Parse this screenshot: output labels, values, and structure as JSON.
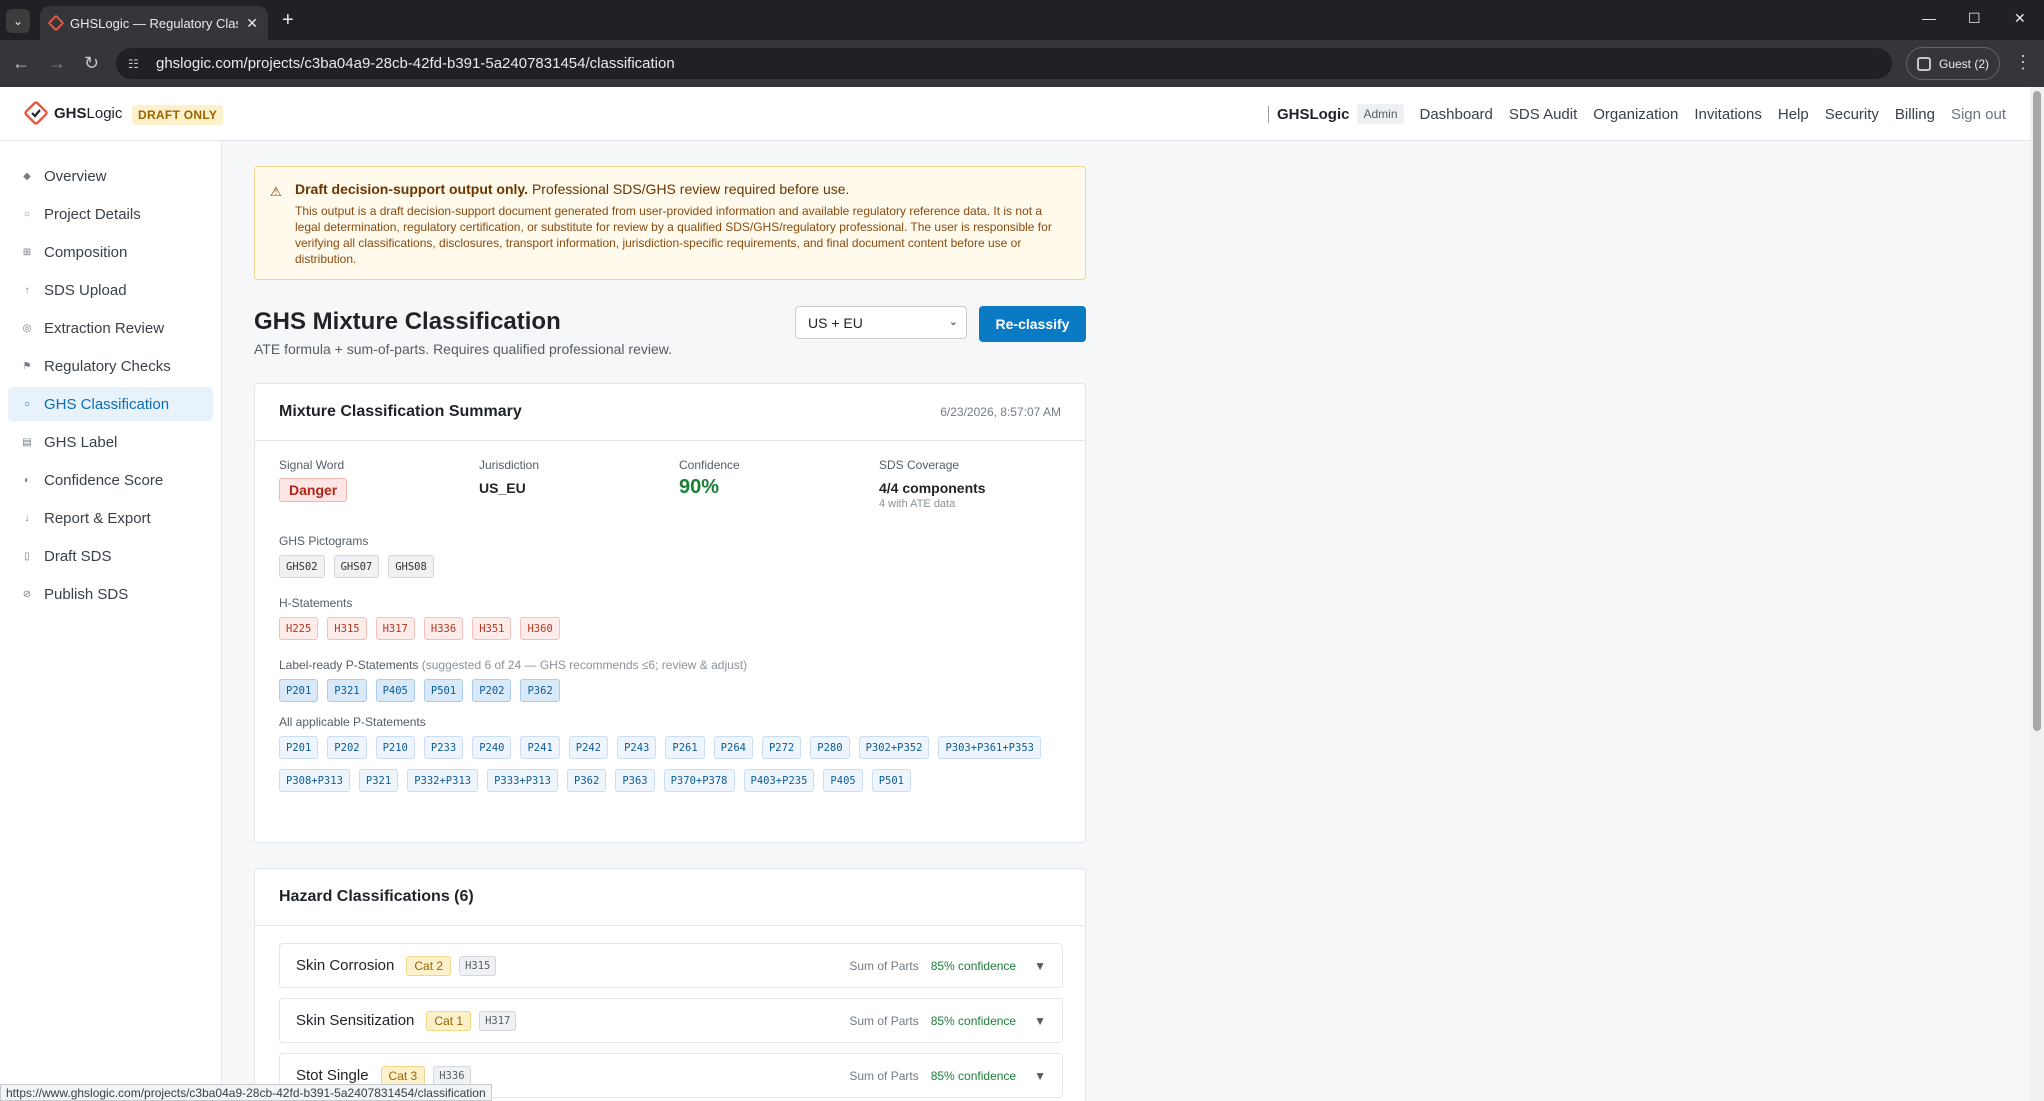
{
  "browser": {
    "tab_title": "GHSLogic — Regulatory Classifi",
    "url": "ghslogic.com/projects/c3ba04a9-28cb-42fd-b391-5a2407831454/classification",
    "profile_label": "Guest (2)",
    "status_url": "https://www.ghslogic.com/projects/c3ba04a9-28cb-42fd-b391-5a2407831454/classification"
  },
  "header": {
    "logo_bold": "GHS",
    "logo_rest": "Logic",
    "draft_badge": "DRAFT ONLY",
    "brand": "GHSLogic",
    "role_badge": "Admin",
    "nav": [
      "Dashboard",
      "SDS Audit",
      "Organization",
      "Invitations",
      "Help",
      "Security",
      "Billing"
    ],
    "signout": "Sign out"
  },
  "sidebar": {
    "items": [
      {
        "label": "Overview",
        "icon": "diamond-icon",
        "glyph": "◆"
      },
      {
        "label": "Project Details",
        "icon": "circle-icon",
        "glyph": "○"
      },
      {
        "label": "Composition",
        "icon": "grid-icon",
        "glyph": "⊞"
      },
      {
        "label": "SDS Upload",
        "icon": "upload-icon",
        "glyph": "↑"
      },
      {
        "label": "Extraction Review",
        "icon": "target-icon",
        "glyph": "◎"
      },
      {
        "label": "Regulatory Checks",
        "icon": "flag-icon",
        "glyph": "⚑"
      },
      {
        "label": "GHS Classification",
        "icon": "circle-icon",
        "glyph": "○"
      },
      {
        "label": "GHS Label",
        "icon": "label-icon",
        "glyph": "▤"
      },
      {
        "label": "Confidence Score",
        "icon": "half-circle-icon",
        "glyph": "◐"
      },
      {
        "label": "Report & Export",
        "icon": "download-icon",
        "glyph": "↓"
      },
      {
        "label": "Draft SDS",
        "icon": "document-icon",
        "glyph": "▯"
      },
      {
        "label": "Publish SDS",
        "icon": "link-icon",
        "glyph": "⊘"
      }
    ],
    "active_index": 6
  },
  "disclaimer": {
    "title_bold": "Draft decision-support output only.",
    "title_rest": " Professional SDS/GHS review required before use.",
    "body": "This output is a draft decision-support document generated from user-provided information and available regulatory reference data. It is not a legal determination, regulatory certification, or substitute for review by a qualified SDS/GHS/regulatory professional. The user is responsible for verifying all classifications, disclosures, transport information, jurisdiction-specific requirements, and final document content before use or distribution."
  },
  "page": {
    "title": "GHS Mixture Classification",
    "subtitle": "ATE formula + sum-of-parts. Requires qualified professional review.",
    "jurisdiction_select": "US + EU",
    "reclassify_label": "Re-classify"
  },
  "summary": {
    "title": "Mixture Classification Summary",
    "timestamp": "6/23/2026, 8:57:07 AM",
    "signal_word_label": "Signal Word",
    "signal_word": "Danger",
    "jurisdiction_label": "Jurisdiction",
    "jurisdiction": "US_EU",
    "confidence_label": "Confidence",
    "confidence": "90%",
    "coverage_label": "SDS Coverage",
    "coverage": "4/4 components",
    "coverage_note": "4 with ATE data",
    "pictograms_label": "GHS Pictograms",
    "pictograms": [
      "GHS02",
      "GHS07",
      "GHS08"
    ],
    "h_label": "H-Statements",
    "h_statements": [
      "H225",
      "H315",
      "H317",
      "H336",
      "H351",
      "H360"
    ],
    "label_p_label": "Label-ready P-Statements",
    "label_p_hint": " (suggested 6 of 24 — GHS recommends ≤6; review & adjust)",
    "label_p": [
      "P201",
      "P321",
      "P405",
      "P501",
      "P202",
      "P362"
    ],
    "all_p_label": "All applicable P-Statements",
    "all_p": [
      "P201",
      "P202",
      "P210",
      "P233",
      "P240",
      "P241",
      "P242",
      "P243",
      "P261",
      "P264",
      "P272",
      "P280",
      "P302+P352",
      "P303+P361+P353",
      "P308+P313",
      "P321",
      "P332+P313",
      "P333+P313",
      "P362",
      "P363",
      "P370+P378",
      "P403+P235",
      "P405",
      "P501"
    ]
  },
  "hazards": {
    "title": "Hazard Classifications (6)",
    "rows": [
      {
        "name": "Skin Corrosion",
        "cat": "Cat 2",
        "code": "H315",
        "method": "Sum of Parts",
        "confidence": "85% confidence"
      },
      {
        "name": "Skin Sensitization",
        "cat": "Cat 1",
        "code": "H317",
        "method": "Sum of Parts",
        "confidence": "85% confidence"
      },
      {
        "name": "Stot Single",
        "cat": "Cat 3",
        "code": "H336",
        "method": "Sum of Parts",
        "confidence": "85% confidence"
      }
    ]
  }
}
